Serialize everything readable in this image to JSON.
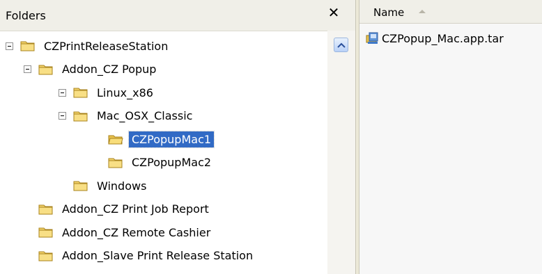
{
  "folders_pane": {
    "title": "Folders",
    "close_glyph": "✕"
  },
  "tree": [
    {
      "label": "CZPrintReleaseStation",
      "expanded": true,
      "depth": 0,
      "icon": "folder-icon"
    },
    {
      "label": "Addon_CZ Popup",
      "expanded": true,
      "depth": 1,
      "icon": "folder-icon"
    },
    {
      "label": "Linux_x86",
      "expanded": true,
      "depth": 2,
      "icon": "folder-icon"
    },
    {
      "label": "Mac_OSX_Classic",
      "expanded": true,
      "depth": 2,
      "icon": "folder-icon"
    },
    {
      "label": "CZPopupMac1",
      "expanded": false,
      "depth": 3,
      "selected": true,
      "icon": "folder-open-icon"
    },
    {
      "label": "CZPopupMac2",
      "expanded": false,
      "depth": 3,
      "icon": "folder-icon"
    },
    {
      "label": "Windows",
      "expanded": false,
      "depth": 2,
      "icon": "folder-icon"
    },
    {
      "label": "Addon_CZ Print Job Report",
      "expanded": false,
      "depth": 1,
      "icon": "folder-icon"
    },
    {
      "label": "Addon_CZ Remote Cashier",
      "expanded": false,
      "depth": 1,
      "icon": "folder-icon"
    },
    {
      "label": "Addon_Slave Print Release Station",
      "expanded": false,
      "depth": 1,
      "icon": "folder-icon"
    }
  ],
  "file_list": {
    "column_header": "Name",
    "sort": "ascending",
    "files": [
      {
        "name": "CZPopup_Mac.app.tar",
        "icon": "archive-file-icon"
      }
    ]
  },
  "colors": {
    "selection": "#316ac5",
    "folder_fill": "#f6d66b",
    "header_bg": "#f0efe8"
  }
}
